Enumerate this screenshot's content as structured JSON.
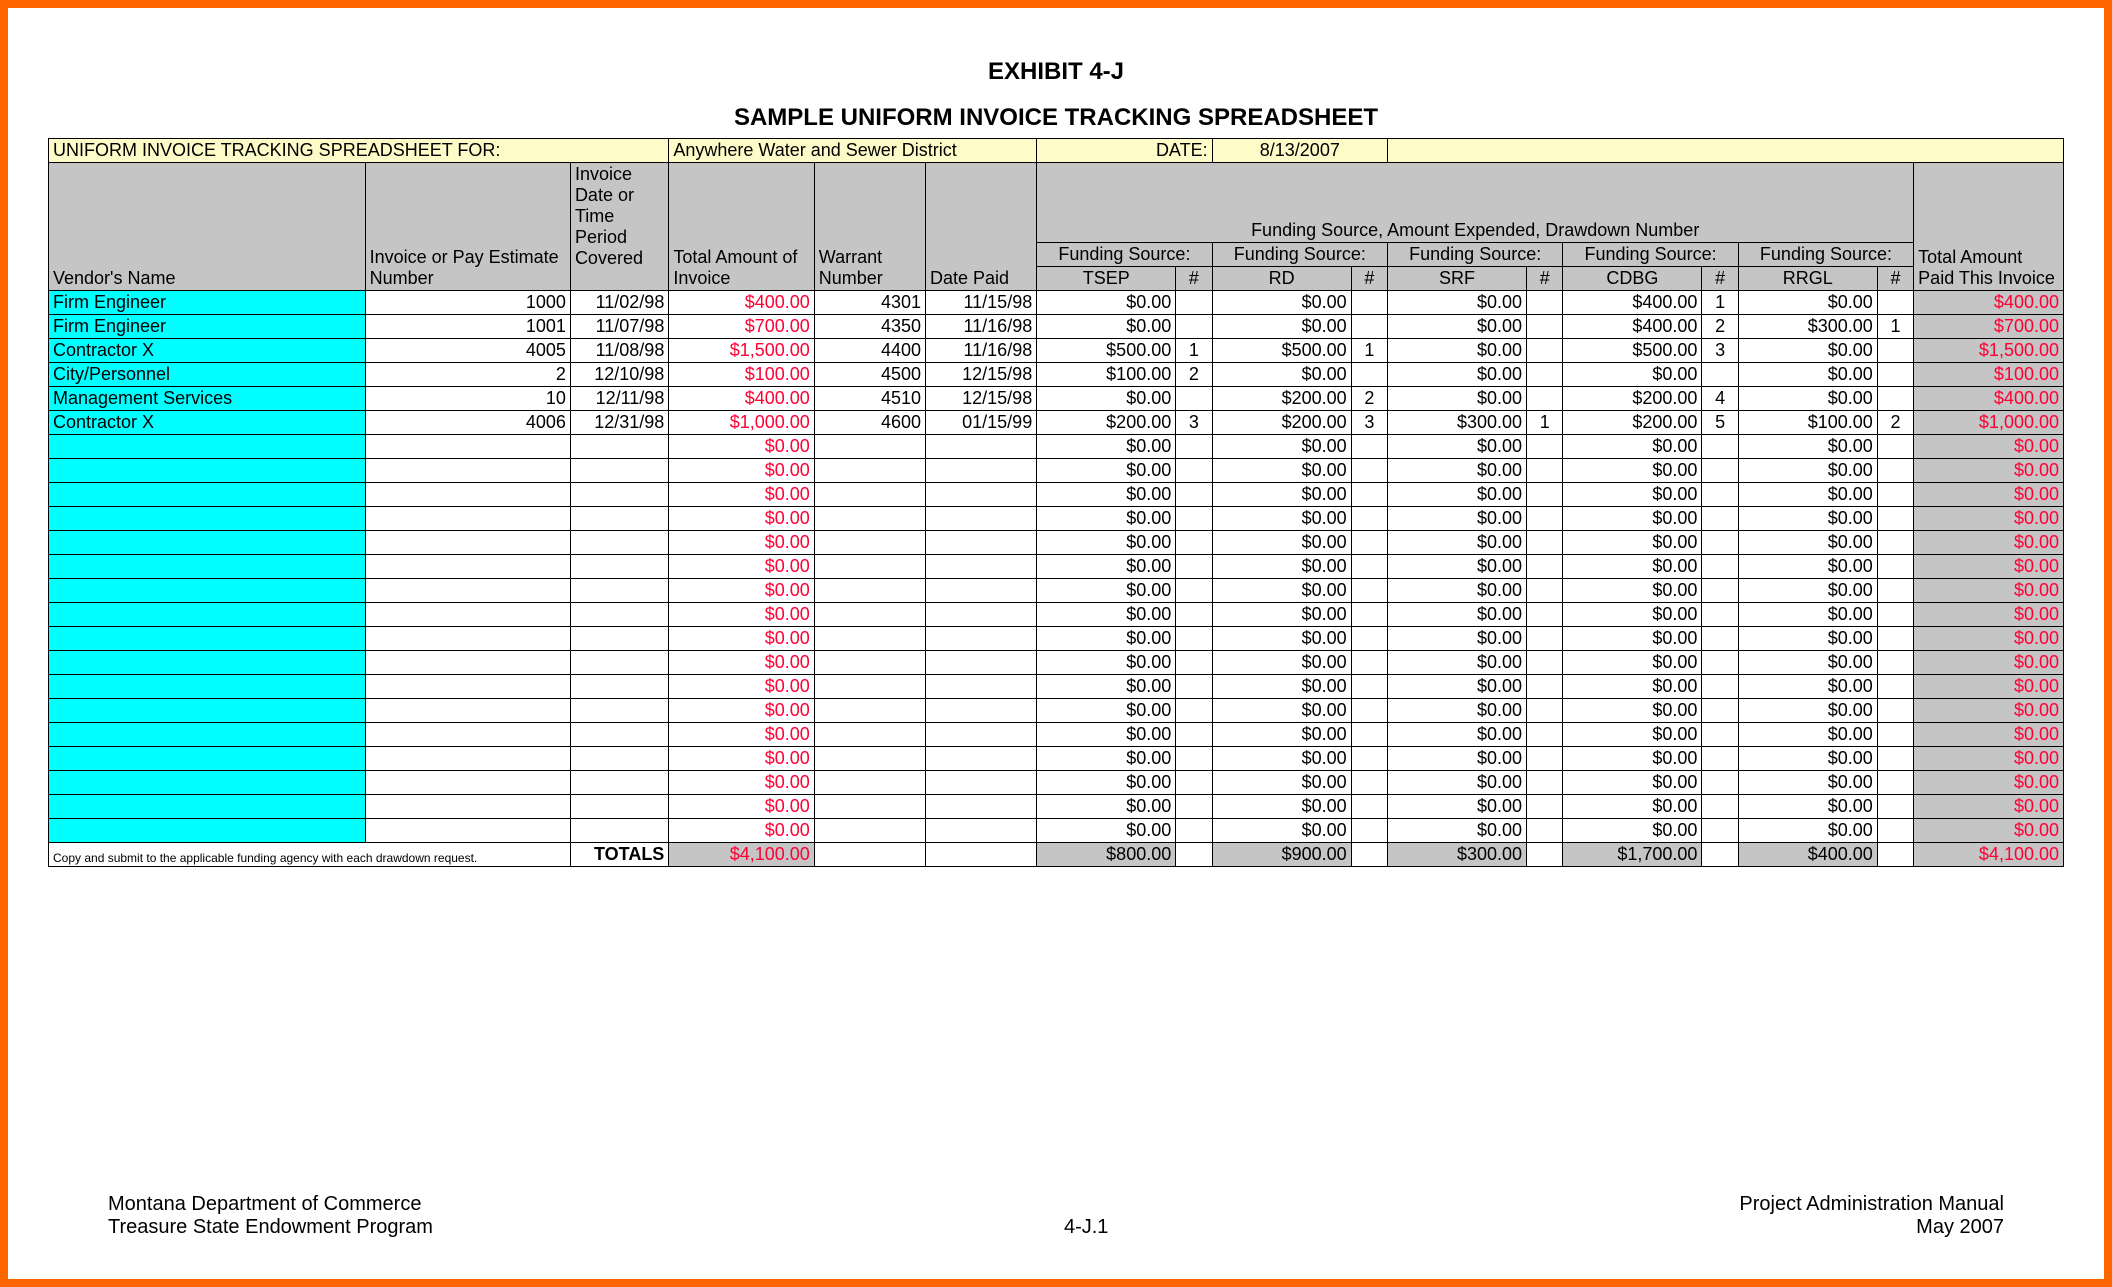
{
  "heading": {
    "exhibit": "EXHIBIT 4-J",
    "title": "SAMPLE UNIFORM INVOICE TRACKING SPREADSHEET"
  },
  "top": {
    "label_for": "UNIFORM INVOICE TRACKING SPREADSHEET FOR:",
    "entity": "Anywhere Water and Sewer District",
    "date_label": "DATE:",
    "date_value": "8/13/2007"
  },
  "columns": {
    "vendor": "Vendor's Name",
    "invoice": "Invoice or Pay Estimate Number",
    "invdate": "Invoice Date or Time Period Covered",
    "totamt": "Total Amount of Invoice",
    "warrant": "Warrant Number",
    "paid": "Date Paid",
    "funding_caption": "Funding Source, Amount Expended, Drawdown Number",
    "fs_label": "Funding Source:",
    "fs1": "TSEP",
    "fs2": "RD",
    "fs3": "SRF",
    "fs4": "CDBG",
    "fs5": "RRGL",
    "hash": "#",
    "total": "Total Amount Paid This Invoice"
  },
  "rows": [
    {
      "vendor": "Firm Engineer",
      "inv": "1000",
      "date": "11/02/98",
      "amt": "$400.00",
      "warr": "4301",
      "paid": "11/15/98",
      "f1": "$0.00",
      "n1": "",
      "f2": "$0.00",
      "n2": "",
      "f3": "$0.00",
      "n3": "",
      "f4": "$400.00",
      "n4": "1",
      "f5": "$0.00",
      "n5": "",
      "tot": "$400.00"
    },
    {
      "vendor": "Firm Engineer",
      "inv": "1001",
      "date": "11/07/98",
      "amt": "$700.00",
      "warr": "4350",
      "paid": "11/16/98",
      "f1": "$0.00",
      "n1": "",
      "f2": "$0.00",
      "n2": "",
      "f3": "$0.00",
      "n3": "",
      "f4": "$400.00",
      "n4": "2",
      "f5": "$300.00",
      "n5": "1",
      "tot": "$700.00"
    },
    {
      "vendor": "Contractor X",
      "inv": "4005",
      "date": "11/08/98",
      "amt": "$1,500.00",
      "warr": "4400",
      "paid": "11/16/98",
      "f1": "$500.00",
      "n1": "1",
      "f2": "$500.00",
      "n2": "1",
      "f3": "$0.00",
      "n3": "",
      "f4": "$500.00",
      "n4": "3",
      "f5": "$0.00",
      "n5": "",
      "tot": "$1,500.00"
    },
    {
      "vendor": "City/Personnel",
      "inv": "2",
      "date": "12/10/98",
      "amt": "$100.00",
      "warr": "4500",
      "paid": "12/15/98",
      "f1": "$100.00",
      "n1": "2",
      "f2": "$0.00",
      "n2": "",
      "f3": "$0.00",
      "n3": "",
      "f4": "$0.00",
      "n4": "",
      "f5": "$0.00",
      "n5": "",
      "tot": "$100.00"
    },
    {
      "vendor": "Management Services",
      "inv": "10",
      "date": "12/11/98",
      "amt": "$400.00",
      "warr": "4510",
      "paid": "12/15/98",
      "f1": "$0.00",
      "n1": "",
      "f2": "$200.00",
      "n2": "2",
      "f3": "$0.00",
      "n3": "",
      "f4": "$200.00",
      "n4": "4",
      "f5": "$0.00",
      "n5": "",
      "tot": "$400.00"
    },
    {
      "vendor": "Contractor X",
      "inv": "4006",
      "date": "12/31/98",
      "amt": "$1,000.00",
      "warr": "4600",
      "paid": "01/15/99",
      "f1": "$200.00",
      "n1": "3",
      "f2": "$200.00",
      "n2": "3",
      "f3": "$300.00",
      "n3": "1",
      "f4": "$200.00",
      "n4": "5",
      "f5": "$100.00",
      "n5": "2",
      "tot": "$1,000.00"
    }
  ],
  "empty_row": {
    "amt": "$0.00",
    "f": "$0.00",
    "tot": "$0.00"
  },
  "empty_count": 17,
  "totals": {
    "footnote": "Copy and submit to the applicable funding agency with each drawdown request.",
    "label": "TOTALS",
    "amt": "$4,100.00",
    "f1": "$800.00",
    "f2": "$900.00",
    "f3": "$300.00",
    "f4": "$1,700.00",
    "f5": "$400.00",
    "tot": "$4,100.00"
  },
  "footer": {
    "left1": "Montana Department of Commerce",
    "left2": "Treasure State Endowment Program",
    "mid": "4-J.1",
    "right1": "Project Administration Manual",
    "right2": "May 2007"
  },
  "chart_data": {
    "type": "table",
    "title": "SAMPLE UNIFORM INVOICE TRACKING SPREADSHEET",
    "entity": "Anywhere Water and Sewer District",
    "date": "8/13/2007",
    "columns": [
      "Vendor's Name",
      "Invoice or Pay Estimate Number",
      "Invoice Date or Time Period Covered",
      "Total Amount of Invoice",
      "Warrant Number",
      "Date Paid",
      "TSEP",
      "TSEP #",
      "RD",
      "RD #",
      "SRF",
      "SRF #",
      "CDBG",
      "CDBG #",
      "RRGL",
      "RRGL #",
      "Total Amount Paid This Invoice"
    ],
    "rows": [
      [
        "Firm Engineer",
        1000,
        "11/02/98",
        400.0,
        4301,
        "11/15/98",
        0.0,
        null,
        0.0,
        null,
        0.0,
        null,
        400.0,
        1,
        0.0,
        null,
        400.0
      ],
      [
        "Firm Engineer",
        1001,
        "11/07/98",
        700.0,
        4350,
        "11/16/98",
        0.0,
        null,
        0.0,
        null,
        0.0,
        null,
        400.0,
        2,
        300.0,
        1,
        700.0
      ],
      [
        "Contractor X",
        4005,
        "11/08/98",
        1500.0,
        4400,
        "11/16/98",
        500.0,
        1,
        500.0,
        1,
        0.0,
        null,
        500.0,
        3,
        0.0,
        null,
        1500.0
      ],
      [
        "City/Personnel",
        2,
        "12/10/98",
        100.0,
        4500,
        "12/15/98",
        100.0,
        2,
        0.0,
        null,
        0.0,
        null,
        0.0,
        null,
        0.0,
        null,
        100.0
      ],
      [
        "Management Services",
        10,
        "12/11/98",
        400.0,
        4510,
        "12/15/98",
        0.0,
        null,
        200.0,
        2,
        0.0,
        null,
        200.0,
        4,
        0.0,
        null,
        400.0
      ],
      [
        "Contractor X",
        4006,
        "12/31/98",
        1000.0,
        4600,
        "01/15/99",
        200.0,
        3,
        200.0,
        3,
        300.0,
        1,
        200.0,
        5,
        100.0,
        2,
        1000.0
      ]
    ],
    "totals": {
      "Total Amount of Invoice": 4100.0,
      "TSEP": 800.0,
      "RD": 900.0,
      "SRF": 300.0,
      "CDBG": 1700.0,
      "RRGL": 400.0,
      "Total Amount Paid This Invoice": 4100.0
    }
  }
}
